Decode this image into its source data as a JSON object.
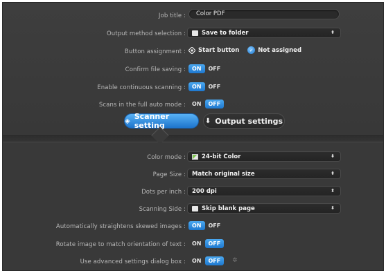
{
  "top": {
    "job_title": {
      "label": "Job title :",
      "value": "Color PDF"
    },
    "output_method": {
      "label": "Output method selection :",
      "value": "Save to folder",
      "icon": "folder-icon"
    },
    "button_assignment": {
      "label": "Button assignment :",
      "options": [
        {
          "label": "Start button",
          "icon": "target-icon",
          "selected": false
        },
        {
          "label": "Not assigned",
          "icon": "check-icon",
          "selected": true
        }
      ]
    },
    "confirm_saving": {
      "label": "Confirm file saving :",
      "on": "ON",
      "off": "OFF",
      "state": "on"
    },
    "continuous_scanning": {
      "label": "Enable continuous scanning :",
      "on": "ON",
      "off": "OFF",
      "state": "on"
    },
    "full_auto": {
      "label": "Scans in the full auto mode :",
      "on": "ON",
      "off": "OFF",
      "state": "off"
    }
  },
  "tabs": [
    {
      "label": "Scanner setting",
      "icon": "scanner-icon",
      "active": true
    },
    {
      "label": "Output settings",
      "icon": "download-arrow-icon",
      "active": false
    }
  ],
  "scanner": {
    "color_mode": {
      "label": "Color mode :",
      "value": "24-bit Color",
      "icon": "color-icon"
    },
    "page_size": {
      "label": "Page Size :",
      "value": "Match original size"
    },
    "dpi": {
      "label": "Dots per inch :",
      "value": "200 dpi"
    },
    "scanning_side": {
      "label": "Scanning Side :",
      "value": "Skip blank page",
      "icon": "page-icon"
    },
    "straighten": {
      "label": "Automatically straightens skewed images :",
      "on": "ON",
      "off": "OFF",
      "state": "on"
    },
    "rotate": {
      "label": "Rotate image to match orientation of text :",
      "on": "ON",
      "off": "OFF",
      "state": "off"
    },
    "advanced": {
      "label": "Use advanced settings dialog box :",
      "on": "ON",
      "off": "OFF",
      "state": "off"
    }
  },
  "colors": {
    "accent": "#1e78cf",
    "panel": "#3a3a3a"
  }
}
